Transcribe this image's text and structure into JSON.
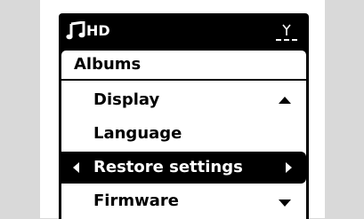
{
  "status_bar": {
    "source_icon": "music-note-icon",
    "source_label": "HD",
    "signal_icon": "wifi-antenna-icon"
  },
  "header": {
    "title": "Albums"
  },
  "menu": {
    "items": [
      {
        "label": "Display",
        "selected": false
      },
      {
        "label": "Language",
        "selected": false
      },
      {
        "label": "Restore settings",
        "selected": true
      },
      {
        "label": "Firmware",
        "selected": false
      }
    ],
    "scroll_up_icon": "scroll-up-arrow-icon",
    "scroll_down_icon": "scroll-down-arrow-icon"
  },
  "colors": {
    "background": "#d9d9d9",
    "screen": "#000000",
    "text": "#000000",
    "highlight_text": "#ffffff"
  }
}
